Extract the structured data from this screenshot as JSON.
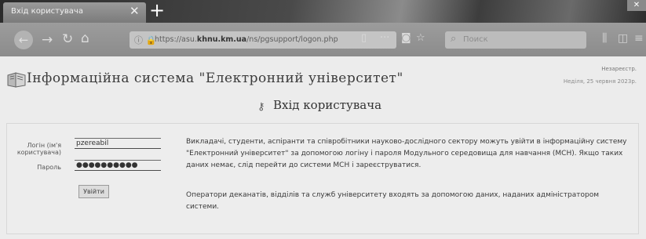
{
  "browser": {
    "tab_title": "Вхід користувача",
    "tab_close_glyph": "✕",
    "newtab_glyph": "+",
    "url_prefix": "https://asu.",
    "url_domain": "khnu.km.ua",
    "url_path": "/ns/pgsupport/logon.php",
    "search_placeholder": "Поиск",
    "nav_icons": [
      "back-icon",
      "forward-icon",
      "reload-icon",
      "home-icon"
    ],
    "toolbar_icons": [
      "reader-icon",
      "more-icon",
      "pocket-icon",
      "bookmark-star-icon"
    ]
  },
  "site": {
    "title": "Інформаційна система \"Електронний університет\"",
    "user_name": "Незареєстр.",
    "date": "Неділя, 25 червня 2023р."
  },
  "login": {
    "title": "Вхід користувача",
    "login_label": "Логін (ім'я користувача)",
    "login_value": "pzereabil",
    "password_label": "Пароль",
    "password_value": "●●●●●●●●●●",
    "submit_label": "Увійти"
  },
  "info": {
    "paragraph1": "Викладачі, студенти, аспіранти та співробітники науково-дослідного сектору можуть увійти в інформаційну систему \"Електронний університет\" за допомогою логіну і пароля Модульного середовища для навчання (МСН). Якщо таких даних немає, слід перейти до системи МСН і зареєструватися.",
    "paragraph2": "Оператори деканатів, відділів та служб університету входять за допомогою даних, наданих адміністратором системи."
  }
}
